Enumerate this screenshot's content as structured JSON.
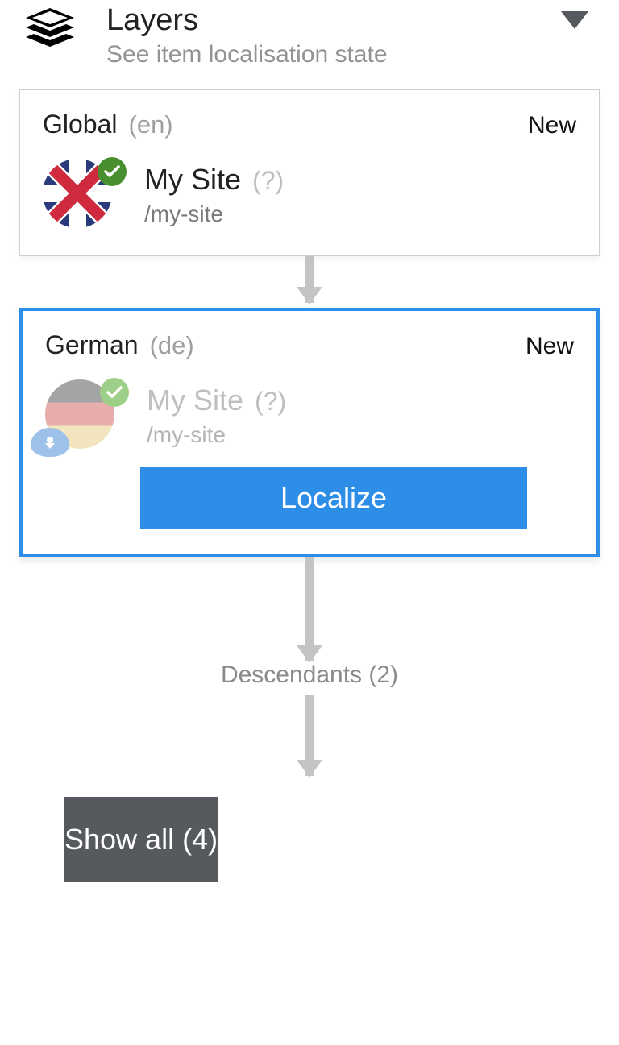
{
  "header": {
    "title": "Layers",
    "subtitle": "See item localisation state"
  },
  "layers": {
    "global": {
      "name": "Global",
      "code": "(en)",
      "status": "New",
      "site_title": "My Site",
      "help": "(?)",
      "path": "/my-site"
    },
    "german": {
      "name": "German",
      "code": "(de)",
      "status": "New",
      "site_title": "My Site",
      "help": "(?)",
      "path": "/my-site",
      "localize_label": "Localize"
    }
  },
  "descendants_label": "Descendants (2)",
  "show_all_label": "Show all (4)"
}
